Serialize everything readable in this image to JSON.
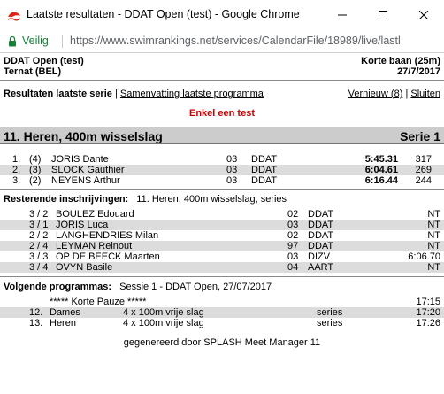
{
  "window": {
    "title": "Laatste resultaten - DDAT Open (test) - Google Chrome",
    "secure_label": "Veilig",
    "url": "https://www.swimrankings.net/services/CalendarFile/18989/live/lastl"
  },
  "header": {
    "meet_name": "DDAT Open (test)",
    "course": "Korte baan (25m)",
    "location": "Ternat (BEL)",
    "date": "27/7/2017"
  },
  "nav": {
    "results_last_heat": "Resultaten laatste serie",
    "separator": "|",
    "summary_link": "Samenvatting laatste programma",
    "refresh_link": "Vernieuw (8)",
    "close_link": "Sluiten"
  },
  "test_label": "Enkel een test",
  "event": {
    "title": "11. Heren, 400m wisselslag",
    "heat": "Serie 1"
  },
  "results": [
    {
      "place": "1.",
      "lane": "(4)",
      "name": "JORIS Dante",
      "age": "03",
      "club": "DDAT",
      "time": "5:45.31",
      "points": "317"
    },
    {
      "place": "2.",
      "lane": "(3)",
      "name": "SLOCK Gauthier",
      "age": "03",
      "club": "DDAT",
      "time": "6:04.61",
      "points": "269"
    },
    {
      "place": "3.",
      "lane": "(2)",
      "name": "NEYENS Arthur",
      "age": "03",
      "club": "DDAT",
      "time": "6:16.44",
      "points": "244"
    }
  ],
  "remaining": {
    "label": "Resterende inschrijvingen:",
    "event": "11. Heren, 400m wisselslag, series",
    "entries": [
      {
        "heat_lane": "3 / 2",
        "name": "BOULEZ Edouard",
        "age": "02",
        "club": "DDAT",
        "seed": "NT"
      },
      {
        "heat_lane": "3 / 1",
        "name": "JORIS Luca",
        "age": "03",
        "club": "DDAT",
        "seed": "NT"
      },
      {
        "heat_lane": "2 / 2",
        "name": "LANGHENDRIES Milan",
        "age": "02",
        "club": "DDAT",
        "seed": "NT"
      },
      {
        "heat_lane": "2 / 4",
        "name": "LEYMAN Reinout",
        "age": "97",
        "club": "DDAT",
        "seed": "NT"
      },
      {
        "heat_lane": "3 / 3",
        "name": "OP DE BEECK Maarten",
        "age": "03",
        "club": "DIZV",
        "seed": "6:06.70"
      },
      {
        "heat_lane": "3 / 4",
        "name": "OVYN Basile",
        "age": "04",
        "club": "AART",
        "seed": "NT"
      }
    ]
  },
  "next": {
    "label": "Volgende programmas:",
    "session": "Sessie 1 - DDAT Open, 27/07/2017",
    "items": [
      {
        "num": "",
        "name": "***** Korte Pauze *****",
        "distance": "",
        "type": "",
        "time": "17:15"
      },
      {
        "num": "12.",
        "name": "Dames",
        "distance": "4 x 100m vrije slag",
        "type": "series",
        "time": "17:20"
      },
      {
        "num": "13.",
        "name": "Heren",
        "distance": "4 x 100m vrije slag",
        "type": "series",
        "time": "17:26"
      }
    ]
  },
  "footer": "gegenereerd door SPLASH Meet Manager 11",
  "colors": {
    "row_shade": "#dcdcdc",
    "event_bar": "#cccccc",
    "test_red": "#cc0000",
    "secure_green": "#188038"
  }
}
